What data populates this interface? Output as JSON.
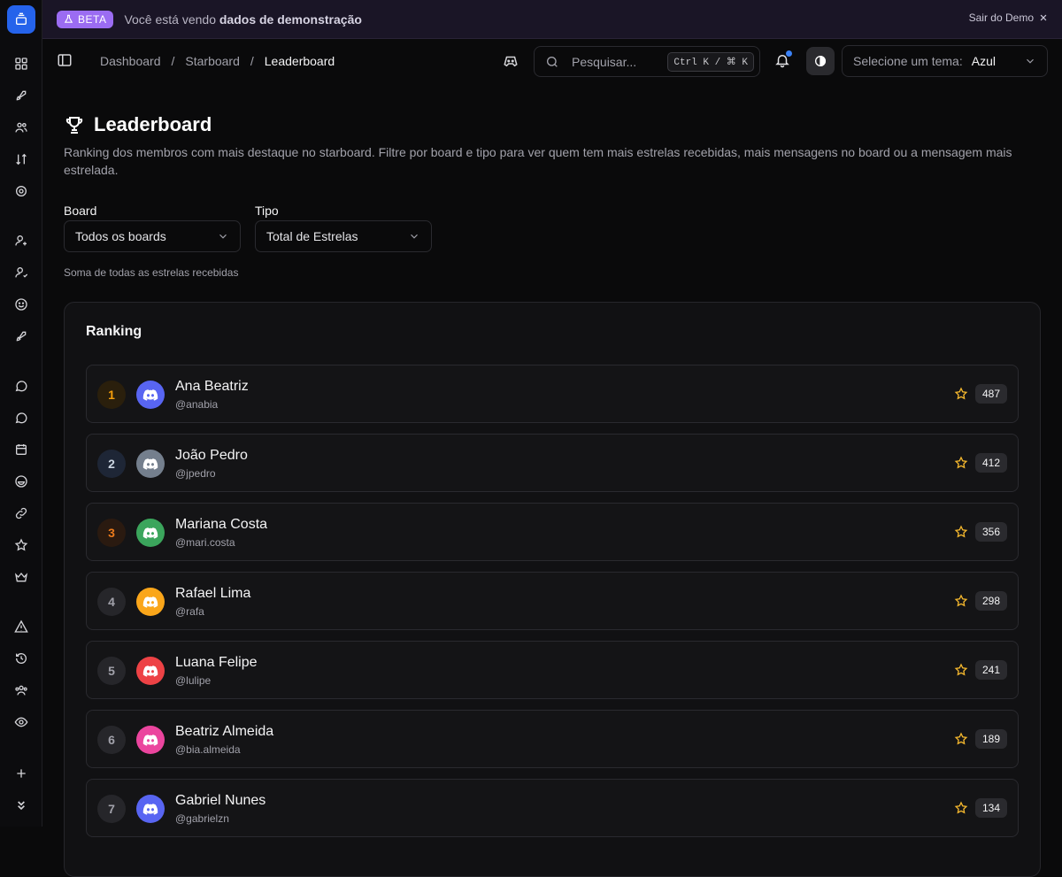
{
  "banner": {
    "badge": "BETA",
    "text_prefix": "Você está vendo ",
    "text_bold": "dados de demonstração",
    "exit_label": "Sair do Demo"
  },
  "sidebar": {
    "items": [
      "dashboard-icon",
      "rocket-icon",
      "users-icon",
      "sort-icon",
      "settings-icon",
      "user-plus-icon",
      "user-check-icon",
      "smile-icon",
      "rocket-icon",
      "message-icon",
      "message-circle-icon",
      "calendar-icon",
      "emoji-icon",
      "link-icon",
      "star-icon",
      "crown-icon",
      "alert-icon",
      "history-icon",
      "team-icon",
      "eye-icon",
      "plus-icon",
      "chevrons-down-icon"
    ]
  },
  "breadcrumb": {
    "items": [
      "Dashboard",
      "Starboard",
      "Leaderboard"
    ]
  },
  "search": {
    "placeholder": "Pesquisar...",
    "shortcut": "Ctrl K / ⌘ K"
  },
  "theme": {
    "label": "Selecione um tema:",
    "value": "Azul"
  },
  "page": {
    "title": "Leaderboard",
    "description": "Ranking dos membros com mais destaque no starboard. Filtre por board e tipo para ver quem tem mais estrelas recebidas, mais mensagens no board ou a mensagem mais estrelada."
  },
  "filters": {
    "board_label": "Board",
    "board_value": "Todos os boards",
    "type_label": "Tipo",
    "type_value": "Total de Estrelas",
    "hint": "Soma de todas as estrelas recebidas"
  },
  "ranking": {
    "title": "Ranking",
    "rows": [
      {
        "rank": "1",
        "name": "Ana Beatriz",
        "handle": "@anabia",
        "stars": "487",
        "avatar_color": "#5865f2",
        "rank_color": "#f59e0b",
        "rank_bg": "#2a1f0c"
      },
      {
        "rank": "2",
        "name": "João Pedro",
        "handle": "@jpedro",
        "stars": "412",
        "avatar_color": "#747f8d",
        "rank_color": "#cbd5e1",
        "rank_bg": "#1e2636"
      },
      {
        "rank": "3",
        "name": "Mariana Costa",
        "handle": "@mari.costa",
        "stars": "356",
        "avatar_color": "#3ba55c",
        "rank_color": "#ea7a1c",
        "rank_bg": "#2a1a10"
      },
      {
        "rank": "4",
        "name": "Rafael Lima",
        "handle": "@rafa",
        "stars": "298",
        "avatar_color": "#faa61a",
        "rank_color": "#a1a1aa",
        "rank_bg": "#26262a"
      },
      {
        "rank": "5",
        "name": "Luana Felipe",
        "handle": "@lulipe",
        "stars": "241",
        "avatar_color": "#ed4245",
        "rank_color": "#a1a1aa",
        "rank_bg": "#26262a"
      },
      {
        "rank": "6",
        "name": "Beatriz Almeida",
        "handle": "@bia.almeida",
        "stars": "189",
        "avatar_color": "#eb459e",
        "rank_color": "#a1a1aa",
        "rank_bg": "#26262a"
      },
      {
        "rank": "7",
        "name": "Gabriel Nunes",
        "handle": "@gabrielzn",
        "stars": "134",
        "avatar_color": "#5865f2",
        "rank_color": "#a1a1aa",
        "rank_bg": "#26262a"
      }
    ]
  },
  "colors": {
    "accent": "#2563eb",
    "beta": "#9b6cf2",
    "star": "#f5b82e"
  }
}
